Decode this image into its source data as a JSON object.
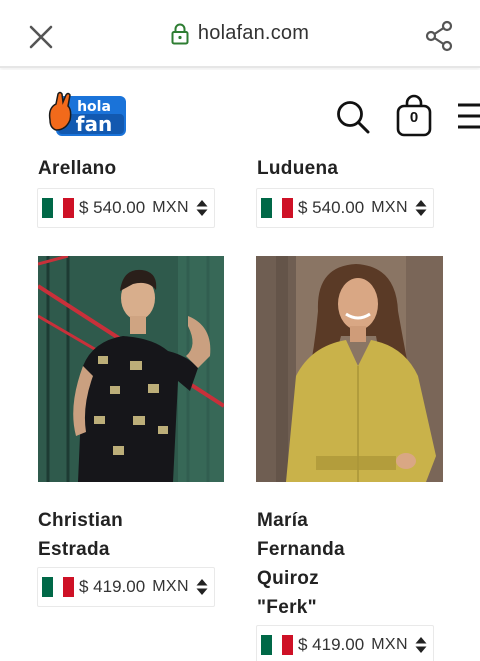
{
  "browser": {
    "url": "holafan.com"
  },
  "header": {
    "logo_top": "hola",
    "logo_bottom": "fan",
    "cart_count": "0"
  },
  "products": [
    {
      "name_lines": [
        "Arellano"
      ],
      "price": "$ 540.00",
      "currency": "MXN"
    },
    {
      "name_lines": [
        "Luduena"
      ],
      "price": "$ 540.00",
      "currency": "MXN"
    },
    {
      "name_lines": [
        "Christian",
        "Estrada"
      ],
      "price": "$ 419.00",
      "currency": "MXN"
    },
    {
      "name_lines": [
        "María",
        "Fernanda",
        "Quiroz",
        "\"Ferk\""
      ],
      "price": "$ 419.00",
      "currency": "MXN"
    }
  ],
  "colors": {
    "flag_green": "#006847",
    "flag_white": "#ffffff",
    "flag_red": "#ce1126",
    "logo_blue": "#1a73d9",
    "logo_orange": "#f26a1b",
    "secure_green": "#2e7d32"
  },
  "icons": {
    "close": "close-icon",
    "lock": "lock-icon",
    "share": "share-icon",
    "search": "search-icon",
    "cart": "shopping-bag-icon",
    "menu": "hamburger-menu-icon",
    "sort": "up-down-arrows-icon"
  }
}
